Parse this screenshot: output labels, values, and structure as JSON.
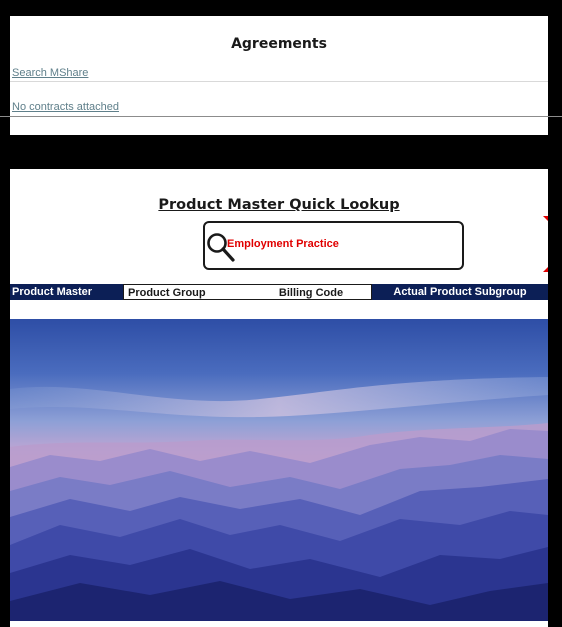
{
  "agreements": {
    "title": "Agreements",
    "search_link": "Search MShare",
    "no_contracts_link": "No contracts attached"
  },
  "lookup": {
    "title": "Product Master Quick Lookup",
    "search_value": "Employment Practice",
    "columns": [
      "Product  Master",
      "Product Group",
      "Billing Code",
      "Actual Product Subgroup"
    ]
  },
  "colors": {
    "header_navy": "#0c1f56",
    "search_text_red": "#e00000",
    "link_teal": "#5f7f8a"
  },
  "icons": [
    "magnifier-icon"
  ]
}
